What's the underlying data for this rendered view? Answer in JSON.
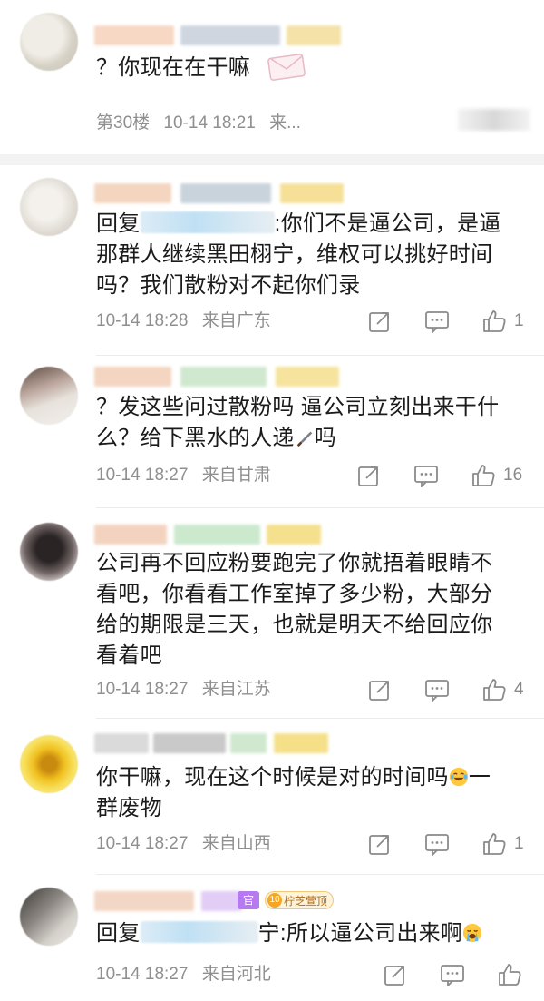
{
  "colors": {
    "meta_text": "#8f8f8f",
    "body_text": "#1b1b1b",
    "divider": "#f2f2f2",
    "badge_orange": "#f5a623",
    "guan_purple": "#b57af0"
  },
  "comments": [
    {
      "text": "？你现在在干嘛",
      "floor": "第30楼",
      "time": "10-14 18:21",
      "source": "来...",
      "icons": [
        "envelope-sticker-icon"
      ]
    },
    {
      "reply_prefix": "回复",
      "reply_suffix": ":你们不是逼公司，是逼",
      "text_lines": [
        "那群人继续黑田栩宁，维权可以挑好时间",
        "吗？我们散粉对不起你们录"
      ],
      "time": "10-14 18:28",
      "source": "来自广东",
      "likes": "1",
      "icons": [
        "share-icon",
        "comment-icon",
        "like-icon"
      ]
    },
    {
      "text_lines": [
        "？发这些问过散粉吗 逼公司立刻出来干什",
        "么？给下黑水的人递",
        "吗"
      ],
      "time": "10-14 18:27",
      "source": "来自甘肃",
      "likes": "16",
      "icons": [
        "knife-emoji-icon",
        "share-icon",
        "comment-icon",
        "like-icon"
      ]
    },
    {
      "text_lines": [
        "公司再不回应粉要跑完了你就捂着眼睛不",
        "看吧，你看看工作室掉了多少粉，大部分",
        "给的期限是三天，也就是明天不给回应你",
        "看着吧"
      ],
      "time": "10-14 18:27",
      "source": "来自江苏",
      "likes": "4",
      "icons": [
        "share-icon",
        "comment-icon",
        "like-icon"
      ]
    },
    {
      "text_lines": [
        "你干嘛，现在这个时候是对的时间吗",
        "一",
        "群废物"
      ],
      "time": "10-14 18:27",
      "source": "来自山西",
      "likes": "1",
      "icons": [
        "laugh-cry-emoji-icon",
        "share-icon",
        "comment-icon",
        "like-icon"
      ]
    },
    {
      "reply_prefix": "回复",
      "reply_suffix": "宁:所以逼公司出来啊",
      "time": "10-14 18:27",
      "source": "来自河北",
      "badge_guan": "官",
      "badge_level": "10",
      "badge_text": "柠芝萱顶",
      "icons": [
        "crying-emoji-icon",
        "share-icon",
        "comment-icon",
        "like-icon"
      ]
    }
  ]
}
